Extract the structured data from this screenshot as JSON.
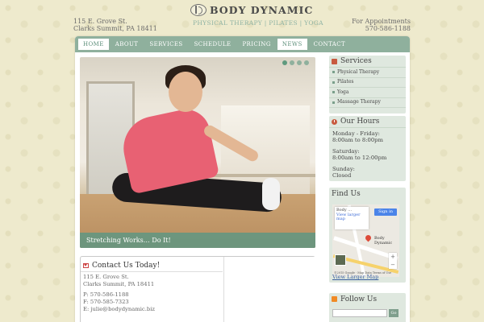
{
  "header": {
    "address_line1": "115 E. Grove St.",
    "address_line2": "Clarks Summit, PA 18411",
    "logo_text": "BODY DYNAMIC",
    "tagline": "PHYSICAL THERAPY | PILATES | YOGA",
    "appointments_label": "For Appointments",
    "appointments_phone": "570-586-1188"
  },
  "nav": {
    "items": [
      {
        "label": "HOME"
      },
      {
        "label": "ABOUT"
      },
      {
        "label": "SERVICES"
      },
      {
        "label": "SCHEDULE"
      },
      {
        "label": "PRICING"
      },
      {
        "label": "NEWS"
      },
      {
        "label": "CONTACT"
      }
    ],
    "active": "HOME",
    "highlight": "NEWS"
  },
  "hero": {
    "caption": "Stretching Works… Do It!",
    "slide_count": 4,
    "active_slide": 1
  },
  "contact": {
    "title": "Contact Us Today!",
    "address_line1": "115 E. Grove St.",
    "address_line2": "Clarks Summit, PA 18411",
    "phone": "P: 570-586-1188",
    "fax": "F: 570-585-7323",
    "email": "E: julie@bodydynamic.biz"
  },
  "services": {
    "title": "Services",
    "items": [
      "Physical Therapy",
      "Pilates",
      "Yoga",
      "Massage Therapy"
    ]
  },
  "hours": {
    "title": "Our Hours",
    "weekday_label": "Monday - Friday:",
    "weekday_hours": "8:00am to 8:00pm",
    "saturday_label": "Saturday:",
    "saturday_hours": "8:00am to 12:00pm",
    "sunday_label": "Sunday:",
    "sunday_hours": "Closed"
  },
  "find_us": {
    "title": "Find Us",
    "card_title": "Body ...",
    "card_link": "View larger map",
    "signin": "Sign in",
    "pin_label": "Body Dynamic",
    "footer": "©2015 Google · Map Data   Terms of Use",
    "larger_map_link": "View Larger Map"
  },
  "follow": {
    "title": "Follow Us",
    "button": "Go"
  },
  "colors": {
    "accent": "#8fb09d",
    "sidebar_bg": "#dfe8df",
    "page_bg": "#eeeacd"
  }
}
